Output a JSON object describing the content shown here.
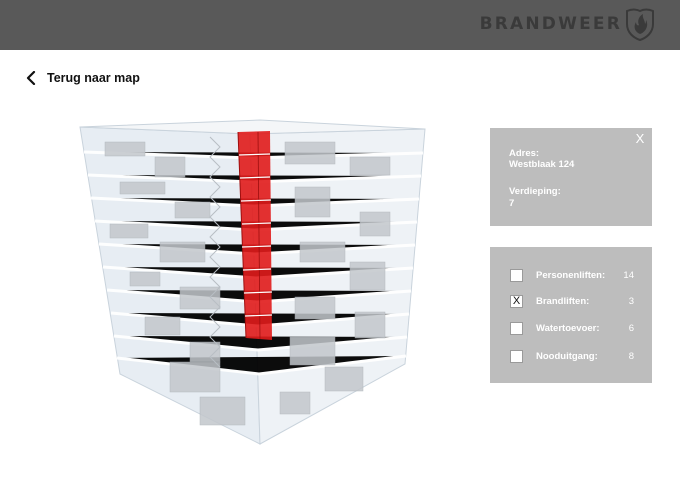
{
  "header": {
    "brand": "BRANDWEER",
    "logo_icon": "brandweer-flame-logo-icon"
  },
  "nav": {
    "back_label": "Terug naar map",
    "back_icon": "chevron-left-icon"
  },
  "info": {
    "close_label": "X",
    "address_label": "Adres:",
    "address_value": "Westblaak 124",
    "floor_label": "Verdieping:",
    "floor_value": "7"
  },
  "filters": [
    {
      "label": "Personenliften:",
      "count": "14",
      "checked": ""
    },
    {
      "label": "Brandliften:",
      "count": "3",
      "checked": "X"
    },
    {
      "label": "Watertoevoer:",
      "count": "6",
      "checked": ""
    },
    {
      "label": "Nooduitgang:",
      "count": "8",
      "checked": ""
    }
  ],
  "colors": {
    "header_bg": "#595959",
    "panel_bg": "#bdbdbd",
    "highlight_red": "#e01b1b",
    "glass": "#e6ecf2"
  }
}
